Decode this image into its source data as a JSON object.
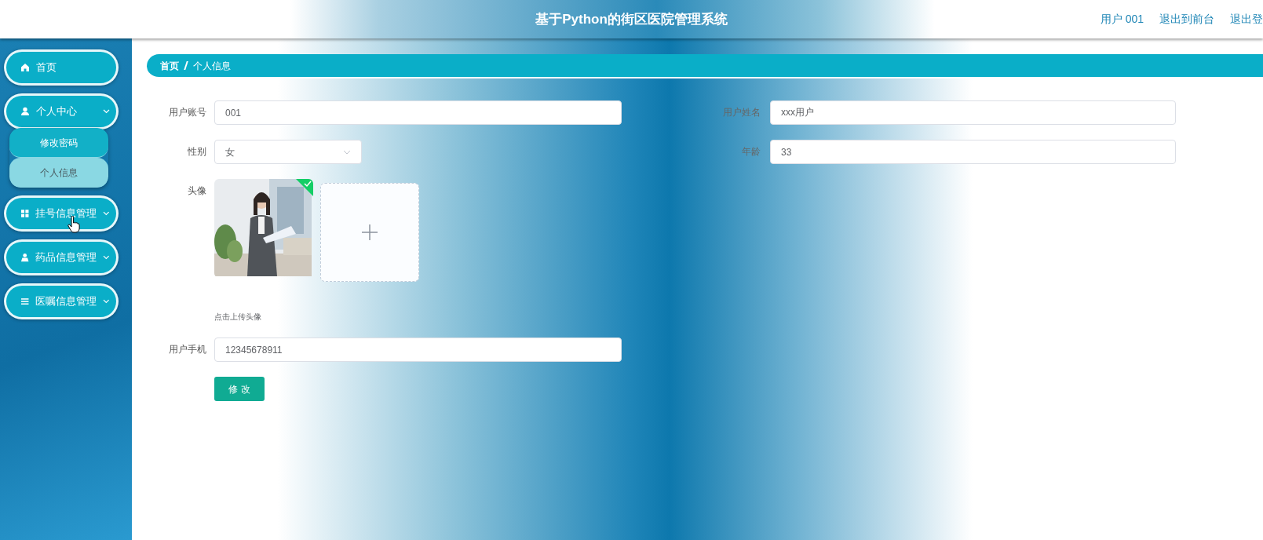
{
  "header": {
    "title": "基于Python的街区医院管理系统",
    "links": [
      "用户 001",
      "退出到前台",
      "退出登"
    ]
  },
  "sidebar": {
    "items": [
      {
        "label": "首页",
        "kind": "link"
      },
      {
        "label": "个人中心",
        "kind": "group",
        "expanded": true,
        "children": [
          {
            "label": "修改密码",
            "selected": false
          },
          {
            "label": "个人信息",
            "selected": true
          }
        ]
      },
      {
        "label": "挂号信息管理",
        "kind": "group"
      },
      {
        "label": "药品信息管理",
        "kind": "group"
      },
      {
        "label": "医嘱信息管理",
        "kind": "group"
      }
    ]
  },
  "breadcrumb": [
    "首页",
    "个人信息"
  ],
  "form": {
    "rows": [
      [
        {
          "kind": "text",
          "label": "用户账号",
          "value": "001"
        },
        {
          "kind": "text",
          "label": "用户姓名",
          "value": "xxx用户"
        }
      ],
      [
        {
          "kind": "select",
          "label": "性别",
          "value": "女"
        },
        {
          "kind": "text",
          "label": "年龄",
          "value": "33"
        }
      ],
      [
        {
          "label": "头像",
          "uploaded": true,
          "hint": "点击上传头像"
        }
      ],
      [
        {
          "kind": "text",
          "label": "用户手机",
          "value": "12345678911"
        }
      ]
    ],
    "submit": "修 改"
  }
}
